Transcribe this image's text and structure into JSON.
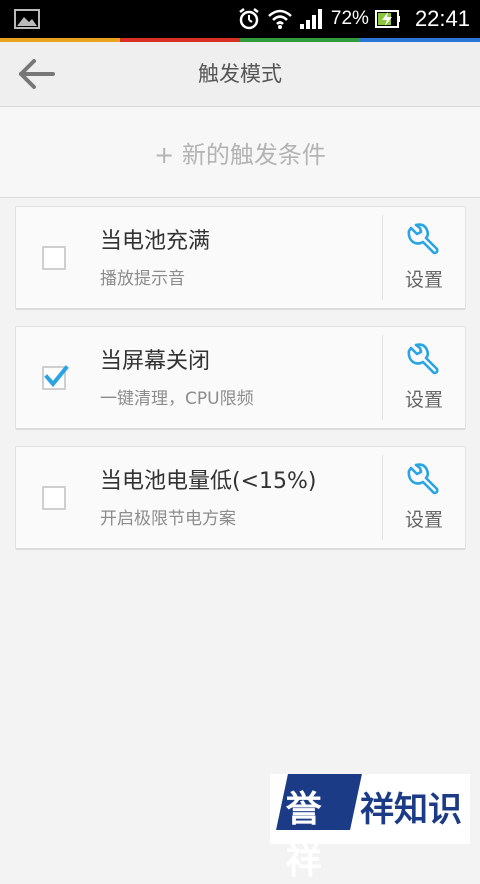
{
  "status_bar": {
    "battery_percent": "72%",
    "time": "22:41"
  },
  "accent_colors": [
    "#e8a321",
    "#d93025",
    "#2f9b3b",
    "#2b76d6"
  ],
  "header": {
    "title": "触发模式",
    "back_icon": "back-arrow-icon"
  },
  "new_trigger": {
    "label": "+ 新的触发条件"
  },
  "triggers": [
    {
      "title": "当电池充满",
      "subtitle": "播放提示音",
      "checked": false,
      "settings_label": "设置"
    },
    {
      "title": "当屏幕关闭",
      "subtitle": "一键清理，CPU限频",
      "checked": true,
      "settings_label": "设置"
    },
    {
      "title": "当电池电量低(<15%)",
      "subtitle": "开启极限节电方案",
      "checked": false,
      "settings_label": "设置"
    }
  ],
  "watermark": {
    "brand": "誉祥祥知识"
  }
}
